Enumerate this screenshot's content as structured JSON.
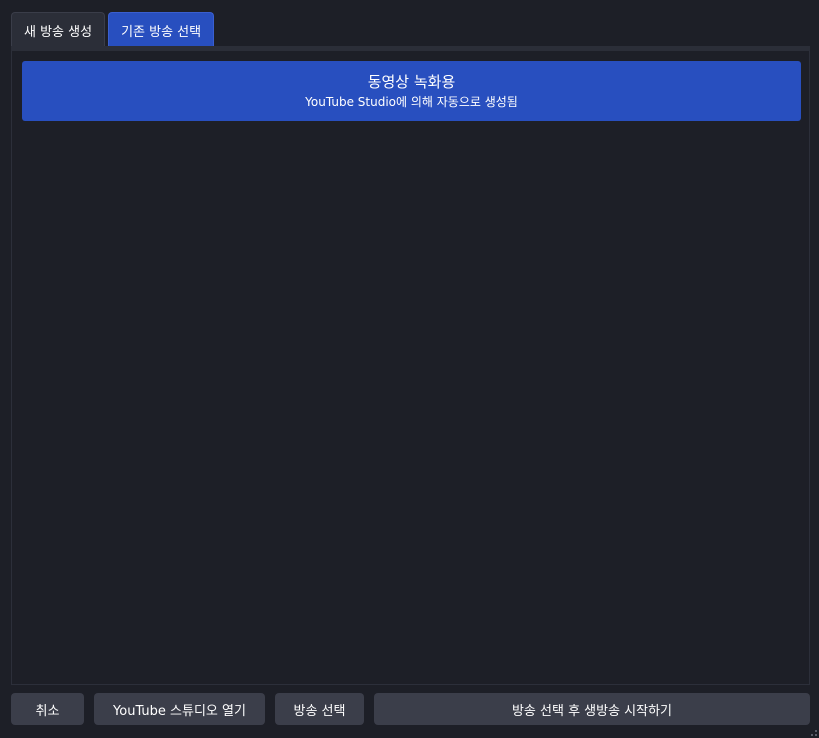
{
  "tabs": {
    "new_broadcast": "새 방송 생성",
    "existing_broadcast": "기존 방송 선택"
  },
  "broadcast_list": {
    "items": [
      {
        "title": "동영상 녹화용",
        "subtitle": "YouTube Studio에 의해 자동으로 생성됨"
      }
    ]
  },
  "buttons": {
    "cancel": "취소",
    "open_studio": "YouTube 스튜디오 열기",
    "select": "방송 선택",
    "select_and_start": "방송 선택 후 생방송 시작하기"
  },
  "colors": {
    "background": "#1d1f27",
    "accent": "#284fbf",
    "button": "#3b3e4a"
  }
}
